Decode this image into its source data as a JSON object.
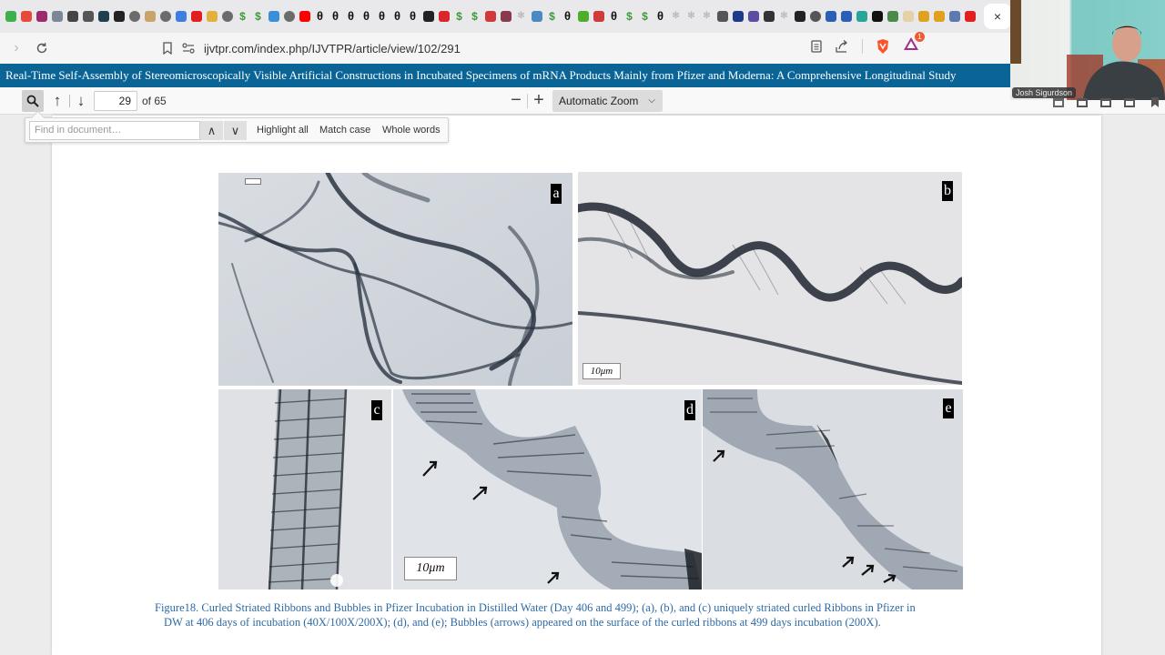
{
  "browser": {
    "bookmark_favicons": [
      {
        "name": "play-favicon",
        "color": "#3fb04b"
      },
      {
        "name": "puzzle-favicon",
        "color": "#e84a3a"
      },
      {
        "name": "play-red-favicon",
        "color": "#9b2b6d"
      },
      {
        "name": "rupee-favicon",
        "color": "#7a8796"
      },
      {
        "name": "dash-favicon",
        "color": "#444444"
      },
      {
        "name": "arrow-favicon",
        "color": "#555555"
      },
      {
        "name": "react-favicon",
        "color": "#1f3e4e"
      },
      {
        "name": "dot-favicon",
        "color": "#222222"
      },
      {
        "name": "globe-favicon",
        "color": "#6b6b6b"
      },
      {
        "name": "mps-favicon",
        "color": "#c8a46a"
      },
      {
        "name": "globe-favicon",
        "color": "#6b6b6b"
      },
      {
        "name": "circle-blue-favicon",
        "color": "#3d7ee0"
      },
      {
        "name": "mic-favicon",
        "color": "#e02020"
      },
      {
        "name": "chat-favicon",
        "color": "#e2b13c"
      },
      {
        "name": "globe-favicon",
        "color": "#6b6b6b"
      },
      {
        "name": "money-favicon",
        "color": "#3a9a3a"
      },
      {
        "name": "money-favicon",
        "color": "#3a9a3a"
      },
      {
        "name": "life-favicon",
        "color": "#3b8fd8"
      },
      {
        "name": "globe-favicon",
        "color": "#6b6b6b"
      },
      {
        "name": "youtube-favicon",
        "color": "#ff0000"
      },
      {
        "name": "theta-favicon",
        "color": "#111111"
      },
      {
        "name": "theta-favicon",
        "color": "#111111"
      },
      {
        "name": "theta-favicon",
        "color": "#111111"
      },
      {
        "name": "theta-favicon",
        "color": "#111111"
      },
      {
        "name": "theta-favicon",
        "color": "#111111"
      },
      {
        "name": "theta-favicon",
        "color": "#111111"
      },
      {
        "name": "theta-favicon",
        "color": "#111111"
      },
      {
        "name": "m-favicon",
        "color": "#222222"
      },
      {
        "name": "g-red-favicon",
        "color": "#d9262b"
      },
      {
        "name": "money-favicon",
        "color": "#3a9a3a"
      },
      {
        "name": "money-favicon",
        "color": "#3a9a3a"
      },
      {
        "name": "s-red-favicon",
        "color": "#d03a3a"
      },
      {
        "name": "img-favicon",
        "color": "#8a3a4a"
      },
      {
        "name": "fern-favicon",
        "color": "#bbbbbb"
      },
      {
        "name": "map-favicon",
        "color": "#4a8ac0"
      },
      {
        "name": "money-favicon",
        "color": "#3a9a3a"
      },
      {
        "name": "theta-favicon",
        "color": "#111111"
      },
      {
        "name": "rt-favicon",
        "color": "#4caf2a"
      },
      {
        "name": "s-red-favicon",
        "color": "#d03a3a"
      },
      {
        "name": "theta-favicon",
        "color": "#111111"
      },
      {
        "name": "money-favicon",
        "color": "#3a9a3a"
      },
      {
        "name": "money-favicon",
        "color": "#3a9a3a"
      },
      {
        "name": "theta-favicon",
        "color": "#111111"
      },
      {
        "name": "fern-favicon",
        "color": "#bbbbbb"
      },
      {
        "name": "fern-favicon",
        "color": "#bbbbbb"
      },
      {
        "name": "fern-favicon",
        "color": "#bbbbbb"
      },
      {
        "name": "eye-favicon",
        "color": "#555555"
      },
      {
        "name": "re-favicon",
        "color": "#1e3a8a"
      },
      {
        "name": "flag-favicon",
        "color": "#5b4ea0"
      },
      {
        "name": "pin-favicon",
        "color": "#333333"
      },
      {
        "name": "fern-favicon",
        "color": "#bbbbbb"
      },
      {
        "name": "knight-favicon",
        "color": "#222222"
      },
      {
        "name": "globe-favicon",
        "color": "#555555"
      },
      {
        "name": "gof-favicon",
        "color": "#2a5fb5"
      },
      {
        "name": "gof-favicon",
        "color": "#2a5fb5"
      },
      {
        "name": "q-favicon",
        "color": "#26a69a"
      },
      {
        "name": "notion-favicon",
        "color": "#111111"
      },
      {
        "name": "tree-favicon",
        "color": "#4a8a4a"
      },
      {
        "name": "hand-favicon",
        "color": "#e3d2a8"
      },
      {
        "name": "shield-favicon",
        "color": "#e0a020"
      },
      {
        "name": "shield-favicon",
        "color": "#e0a020"
      },
      {
        "name": "bnc-favicon",
        "color": "#5a7ab0"
      },
      {
        "name": "cow-favicon",
        "color": "#e02020"
      }
    ],
    "active_tab_close": "×",
    "trailing_favicons": [
      {
        "name": "fern-favicon",
        "color": "#bbbbbb"
      },
      {
        "name": "g-blue-favicon",
        "color": "#1a3f8a"
      },
      {
        "name": "dots-favicon",
        "color": "#222222"
      },
      {
        "name": "warning-favicon",
        "color": "#e0b020"
      },
      {
        "name": "fern-favicon",
        "color": "#bbbbbb"
      },
      {
        "name": "fern-favicon",
        "color": "#bbbbbb"
      },
      {
        "name": "fingerprint-favicon",
        "color": "#d04040"
      }
    ],
    "url": "ijvtpr.com/index.php/IJVTPR/article/view/102/291",
    "rewards_badge": "1"
  },
  "pdf": {
    "title": "Real-Time Self-Assembly of Stereomicroscopically Visible Artificial Constructions in Incubated Specimens of mRNA Products Mainly from Pfizer and Moderna: A Comprehensive Longitudinal Study",
    "current_page": "29",
    "page_count_label": "of 65",
    "zoom_label": "Automatic Zoom",
    "zoom_out": "−",
    "zoom_in": "+"
  },
  "find": {
    "placeholder": "Find in document…",
    "prev": "^",
    "next": "v",
    "highlight_all": "Highlight all",
    "match_case": "Match case",
    "whole_words": "Whole words"
  },
  "figure": {
    "panels": [
      {
        "id": "a",
        "label": "a"
      },
      {
        "id": "b",
        "label": "b",
        "scale": "10μm"
      },
      {
        "id": "c",
        "label": "c"
      },
      {
        "id": "d",
        "label": "d",
        "scale": "10μm"
      },
      {
        "id": "e",
        "label": "e"
      }
    ],
    "caption_line1": "Figure18. Curled Striated Ribbons and Bubbles in Pfizer Incubation in Distilled Water (Day 406 and 499);  (a), (b), and (c) uniquely striated curled Ribbons in Pfizer in",
    "caption_line2": "DW at 406 days of incubation (40X/100X/200X); (d), and (e); Bubbles (arrows) appeared on the surface of the curled ribbons at 499 days incubation (200X)."
  },
  "webcam": {
    "participant_name": "Josh Sigurdson"
  },
  "colors": {
    "title_bar": "#0a6496",
    "caption": "#2f6aa5"
  }
}
